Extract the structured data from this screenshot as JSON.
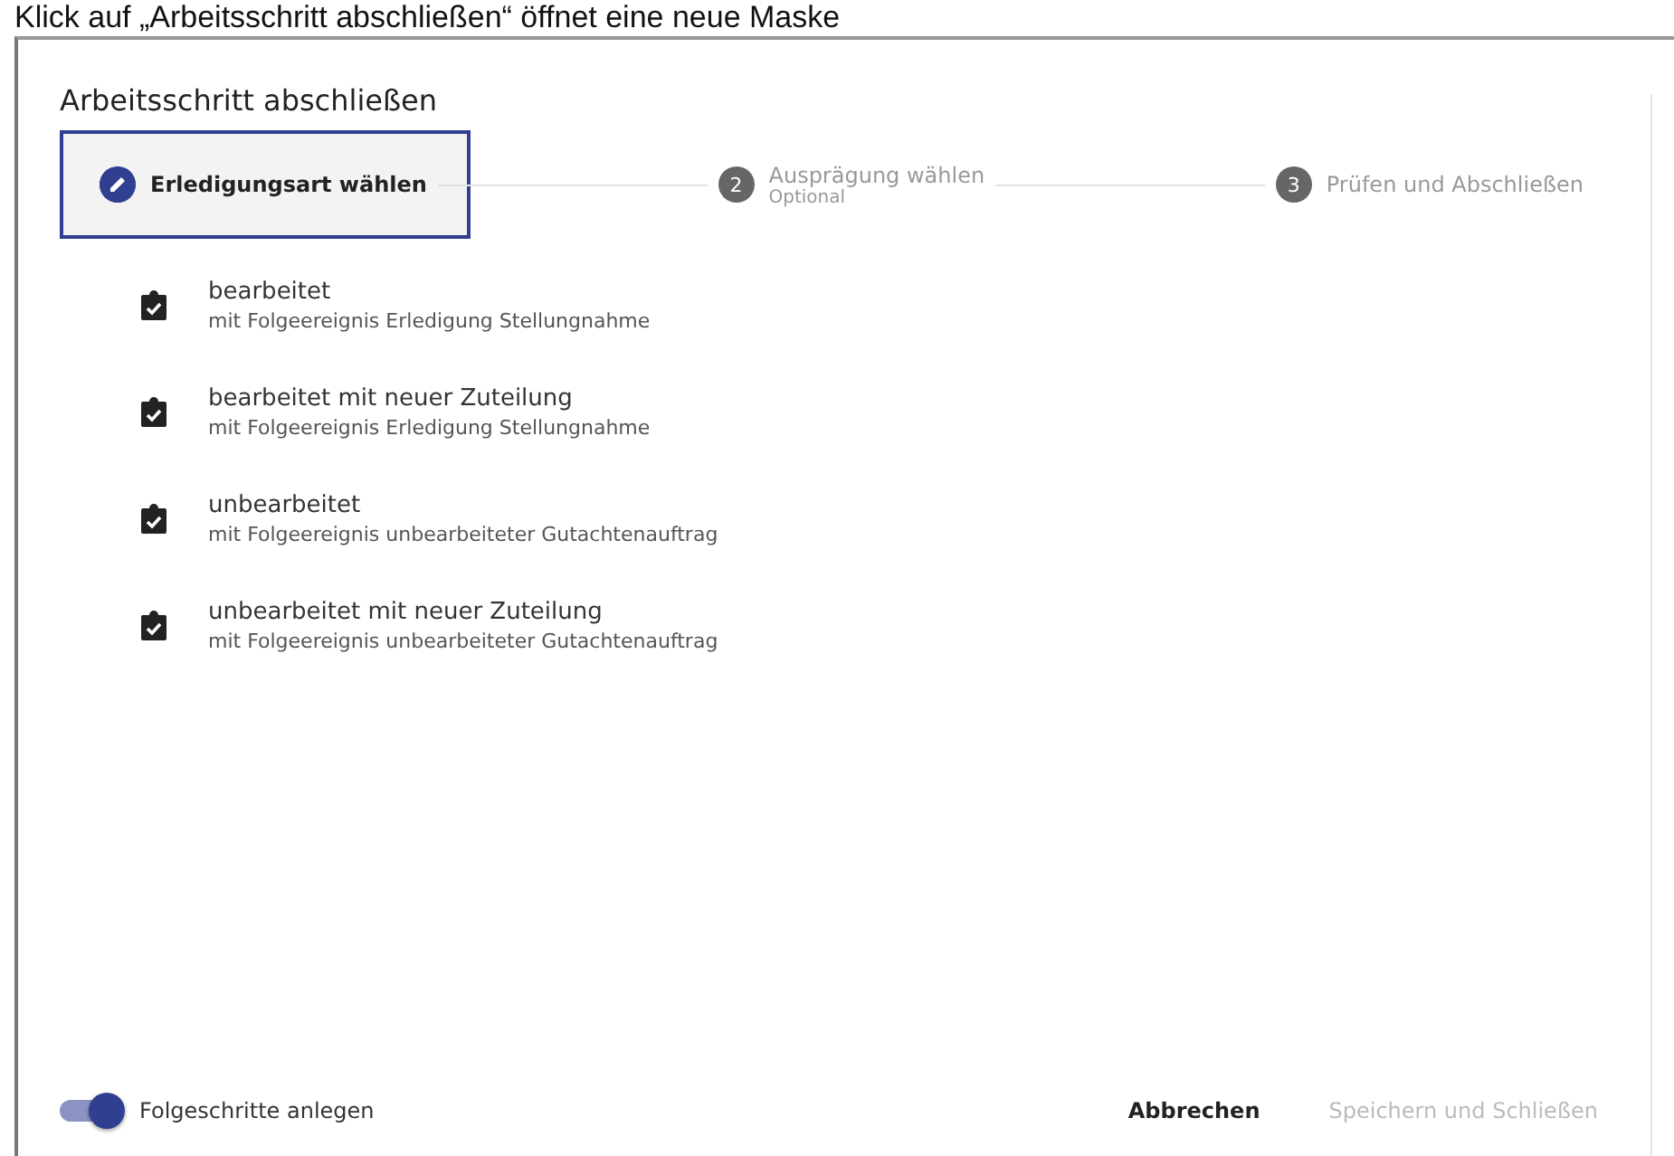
{
  "caption": "Klick auf „Arbeitsschritt abschließen“ öffnet eine neue Maske",
  "dialog": {
    "title": "Arbeitsschritt abschließen",
    "steps": [
      {
        "label": "Erledigungsart wählen",
        "selected": true
      },
      {
        "label": "Ausprägung wählen",
        "number": "2",
        "sublabel": "Optional",
        "selected": false
      },
      {
        "label": "Prüfen und Abschließen",
        "number": "3",
        "selected": false
      }
    ],
    "options": [
      {
        "title": "bearbeitet",
        "subtitle": "mit Folgeereignis Erledigung Stellungnahme"
      },
      {
        "title": "bearbeitet mit neuer Zuteilung",
        "subtitle": "mit Folgeereignis Erledigung Stellungnahme"
      },
      {
        "title": "unbearbeitet",
        "subtitle": "mit Folgeereignis unbearbeiteter Gutachtenauftrag"
      },
      {
        "title": "unbearbeitet mit neuer Zuteilung",
        "subtitle": "mit Folgeereignis unbearbeiteter Gutachtenauftrag"
      }
    ],
    "toggle": {
      "label": "Folgeschritte anlegen",
      "on": true
    },
    "buttons": [
      {
        "label": "Abbrechen",
        "disabled": false
      },
      {
        "label": "Speichern und Schließen",
        "disabled": true
      }
    ]
  }
}
